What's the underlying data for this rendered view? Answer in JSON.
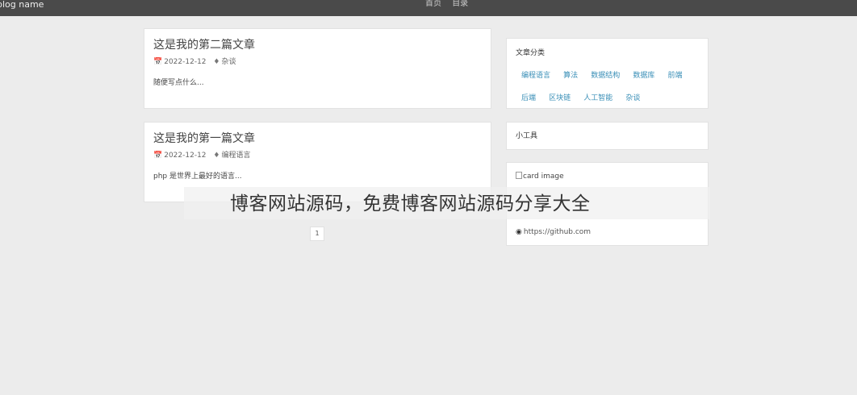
{
  "header": {
    "brand": "blog name",
    "nav": [
      "首页",
      "目录"
    ]
  },
  "posts": [
    {
      "title": "这是我的第二篇文章",
      "date": "2022-12-12",
      "tag": "杂谈",
      "excerpt": "随便写点什么..."
    },
    {
      "title": "这是我的第一篇文章",
      "date": "2022-12-12",
      "tag": "编程语言",
      "excerpt": "php 是世界上最好的语言..."
    }
  ],
  "pagination": {
    "current": "1"
  },
  "sidebar": {
    "categories_title": "文章分类",
    "categories": [
      "编程语言",
      "算法",
      "数据结构",
      "数据库",
      "前端",
      "后端",
      "区块链",
      "人工智能",
      "杂谈"
    ],
    "tools_title": "小工具",
    "card_image_alt": "card image",
    "github_link": "https://github.com"
  },
  "watermark": "博客网站源码，免费博客网站源码分享大全",
  "icons": {
    "calendar": "calendar-icon",
    "tag": "tag-icon",
    "github": "github-icon"
  }
}
